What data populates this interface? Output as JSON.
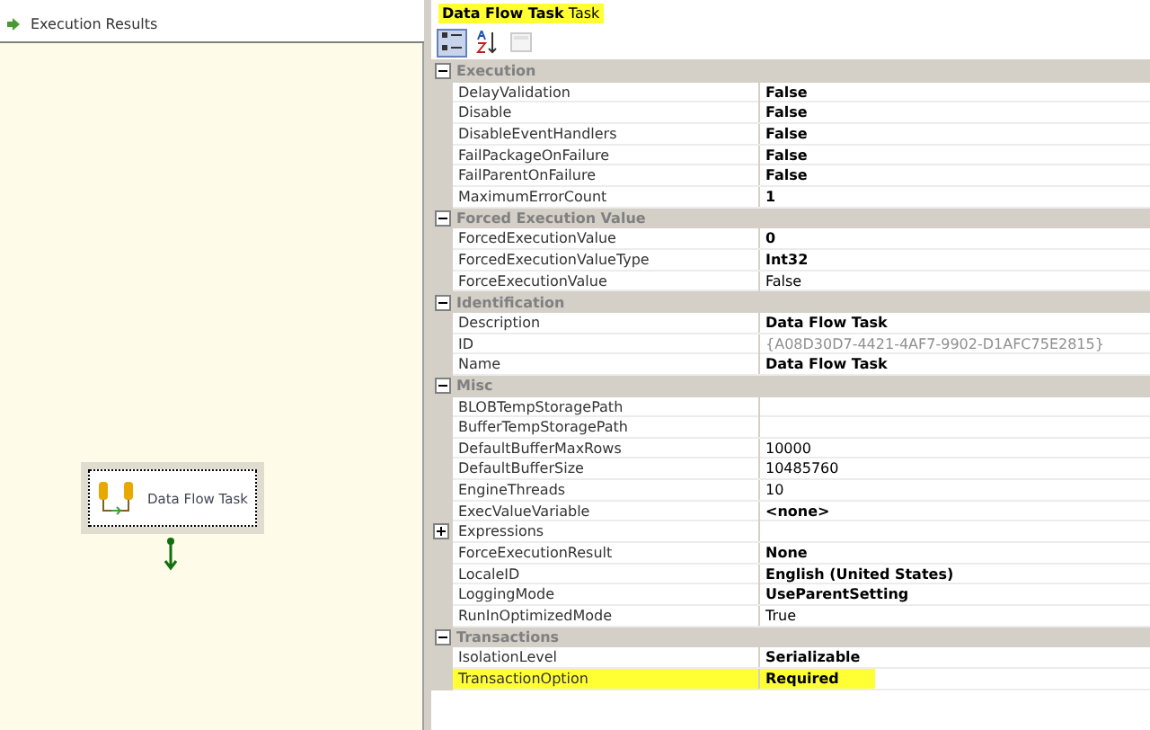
{
  "designer": {
    "tab": {
      "label": "Execution Results"
    },
    "task": {
      "label": "Data Flow Task",
      "selected": true
    }
  },
  "properties": {
    "title": {
      "name": "Data Flow Task",
      "type": "Task",
      "highlighted": true
    },
    "toolbar": [
      {
        "kind": "categorized",
        "selected": true
      },
      {
        "kind": "alphabetical",
        "selected": false
      },
      {
        "kind": "pages",
        "selected": false,
        "disabled": true
      }
    ],
    "categories": [
      {
        "name": "Execution",
        "expanded": true,
        "items": [
          {
            "name": "DelayValidation",
            "value": "False",
            "bold": true
          },
          {
            "name": "Disable",
            "value": "False",
            "bold": true
          },
          {
            "name": "DisableEventHandlers",
            "value": "False",
            "bold": true
          },
          {
            "name": "FailPackageOnFailure",
            "value": "False",
            "bold": true
          },
          {
            "name": "FailParentOnFailure",
            "value": "False",
            "bold": true
          },
          {
            "name": "MaximumErrorCount",
            "value": "1",
            "bold": true
          }
        ]
      },
      {
        "name": "Forced Execution Value",
        "expanded": true,
        "items": [
          {
            "name": "ForcedExecutionValue",
            "value": "0",
            "bold": true
          },
          {
            "name": "ForcedExecutionValueType",
            "value": "Int32",
            "bold": true
          },
          {
            "name": "ForceExecutionValue",
            "value": "False",
            "bold": false
          }
        ]
      },
      {
        "name": "Identification",
        "expanded": true,
        "items": [
          {
            "name": "Description",
            "value": "Data Flow Task",
            "bold": true
          },
          {
            "name": "ID",
            "value": "{A08D30D7-4421-4AF7-9902-D1AFC75E2815}",
            "bold": false,
            "disabled": true
          },
          {
            "name": "Name",
            "value": "Data Flow Task",
            "bold": true
          }
        ]
      },
      {
        "name": "Misc",
        "expanded": true,
        "items": [
          {
            "name": "BLOBTempStoragePath"
          },
          {
            "name": "BufferTempStoragePath"
          },
          {
            "name": "DefaultBufferMaxRows",
            "value": "10000",
            "bold": false
          },
          {
            "name": "DefaultBufferSize",
            "value": "10485760",
            "bold": false
          },
          {
            "name": "EngineThreads",
            "value": "10",
            "bold": false
          },
          {
            "name": "ExecValueVariable",
            "value": "<none>",
            "bold": true
          },
          {
            "name": "Expressions",
            "expanded": false
          },
          {
            "name": "ForceExecutionResult",
            "value": "None",
            "bold": true
          },
          {
            "name": "LocaleID",
            "value": "English (United States)",
            "bold": true
          },
          {
            "name": "LoggingMode",
            "value": "UseParentSetting",
            "bold": true
          },
          {
            "name": "RunInOptimizedMode",
            "value": "True",
            "bold": false
          }
        ]
      },
      {
        "name": "Transactions",
        "expanded": true,
        "items": [
          {
            "name": "IsolationLevel",
            "value": "Serializable",
            "bold": true
          },
          {
            "name": "TransactionOption",
            "value": "Required",
            "bold": true,
            "highlighted": true
          }
        ]
      }
    ]
  }
}
